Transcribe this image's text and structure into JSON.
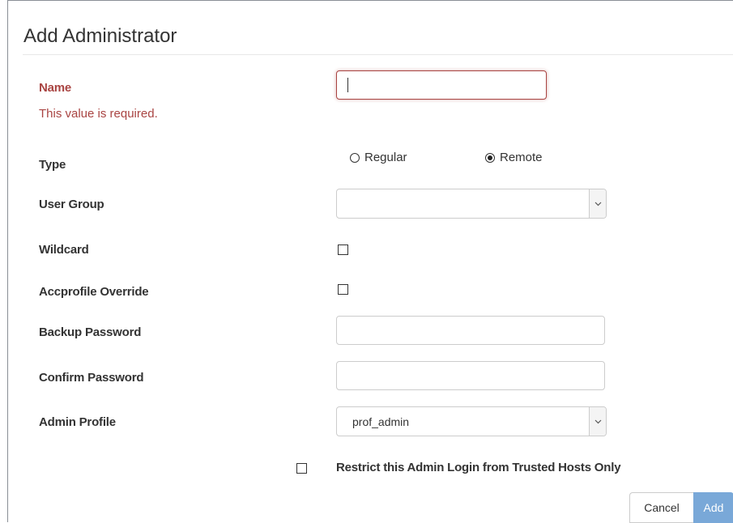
{
  "dialog": {
    "title": "Add Administrator"
  },
  "form": {
    "name": {
      "label": "Name",
      "value": "",
      "error": "This value is required."
    },
    "type": {
      "label": "Type",
      "options": [
        "Regular",
        "Remote"
      ],
      "selected": "Remote"
    },
    "user_group": {
      "label": "User Group",
      "selected": ""
    },
    "wildcard": {
      "label": "Wildcard",
      "checked": false
    },
    "accprofile_override": {
      "label": "Accprofile Override",
      "checked": false
    },
    "backup_password": {
      "label": "Backup Password",
      "value": ""
    },
    "confirm_password": {
      "label": "Confirm Password",
      "value": ""
    },
    "admin_profile": {
      "label": "Admin Profile",
      "selected": "prof_admin"
    },
    "restrict_trusted_hosts": {
      "label": "Restrict this Admin Login from Trusted Hosts Only",
      "checked": false
    }
  },
  "buttons": {
    "cancel": "Cancel",
    "add": "Add"
  },
  "colors": {
    "error": "#a94442",
    "primary_button": "#79a8d8",
    "border": "#cccccc"
  }
}
